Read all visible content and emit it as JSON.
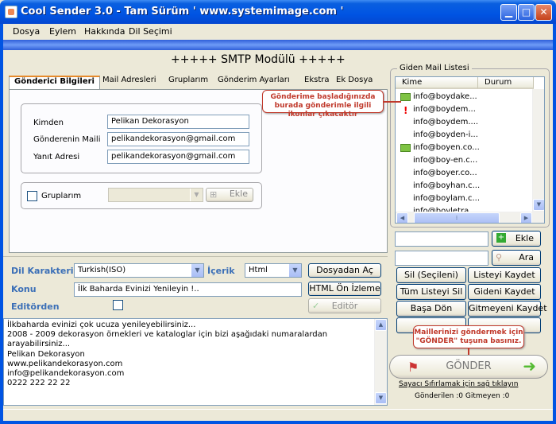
{
  "window": {
    "title": "Cool Sender 3.0 - Tam Sürüm ' www.systemimage.com '"
  },
  "menu": [
    "Dosya",
    "Eylem",
    "Hakkında",
    "Dil Seçimi"
  ],
  "smtp_heading": "+++++ SMTP Modülü +++++",
  "tabs": [
    "Gönderici Bilgileri",
    "Mail Adresleri",
    "Gruplarım",
    "Gönderim Ayarları",
    "Ekstra",
    "Ek Dosya"
  ],
  "sender": {
    "from_label": "Kimden",
    "from_value": "Pelikan Dekorasyon",
    "email_label": "Gönderenin Maili",
    "email_value": "pelikandekorasyon@gmail.com",
    "reply_label": "Yanıt Adresi",
    "reply_value": "pelikandekorasyon@gmail.com"
  },
  "groups": {
    "label": "Gruplarım",
    "add_label": "Ekle",
    "selected": ""
  },
  "compose": {
    "charset_label": "Dil Karakteri",
    "charset_value": "Turkish(ISO)",
    "content_label": "İçerik",
    "content_value": "Html",
    "load_file": "Dosyadan Aç",
    "subject_label": "Konu",
    "subject_value": "İlk Baharda Evinizi Yenileyin !..",
    "html_preview": "HTML Ön İzleme",
    "editor_label": "Editörden",
    "editor_button": "Editör"
  },
  "body_lines": [
    "İlkbaharda evinizi çok ucuza yenileyebilirsiniz...",
    "2008 - 2009 dekorasyon örnekleri ve kataloglar için bizi aşağıdaki numaralardan",
    "arayabilirsiniz...",
    "Pelikan Dekorasyon",
    "www.pelikandekorasyon.com",
    "info@pelikandekorasyon.com",
    "0222 222 22 22"
  ],
  "mail_list": {
    "title": "Giden Mail Listesi",
    "col_to": "Kime",
    "col_status": "Durum",
    "rows": [
      {
        "email": "info@boydake...",
        "icon": "mail-sent-icon"
      },
      {
        "email": "info@boydem...",
        "icon": "error-icon"
      },
      {
        "email": "info@boydem....",
        "icon": ""
      },
      {
        "email": "info@boyden-i...",
        "icon": ""
      },
      {
        "email": "info@boyen.co...",
        "icon": "mail-sent-icon"
      },
      {
        "email": "info@boy-en.c...",
        "icon": ""
      },
      {
        "email": "info@boyer.co...",
        "icon": ""
      },
      {
        "email": "info@boyhan.c...",
        "icon": ""
      },
      {
        "email": "info@boylam.c...",
        "icon": ""
      },
      {
        "email": "info@boyletra...",
        "icon": ""
      }
    ]
  },
  "right_buttons": {
    "add": "Ekle",
    "search": "Ara",
    "delete_selected": "Sil (Seçileni)",
    "save_list": "Listeyi Kaydet",
    "delete_all": "Tüm Listeyi Sil",
    "save_sent": "Gideni Kaydet",
    "go_start": "Başa Dön",
    "save_unsent": "Gitmeyeni Kaydet",
    "send": "GÖNDER",
    "reset_hint": "Sayacı Sıfırlamak için sağ tıklayın",
    "counts": "Gönderilen :0 Gitmeyen :0"
  },
  "callouts": {
    "icons_note": "Gönderime başladığınızda burada gönderimle ilgili ikonlar çıkacaktır",
    "send_note": "Maillerinizi göndermek için \"GÖNDER\" tuşuna basınız."
  },
  "colors": {
    "titlebar": "#0054e3",
    "label_blue": "#3b6fb7",
    "callout_red": "#c0392b"
  }
}
